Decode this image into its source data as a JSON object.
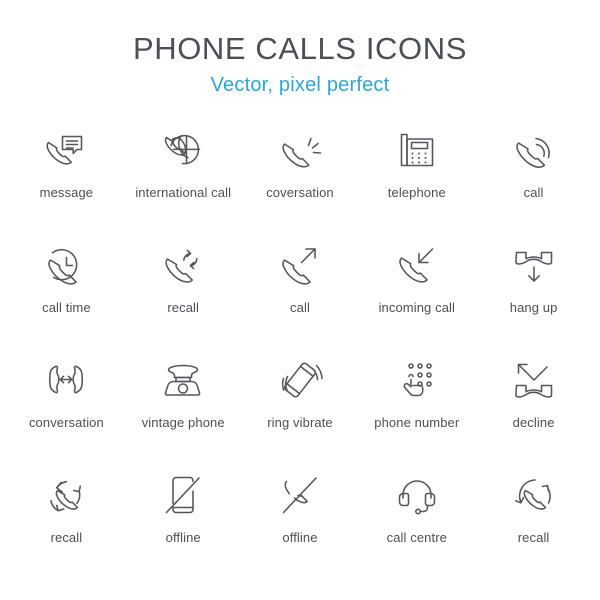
{
  "header": {
    "title": "PHONE CALLS ICONS",
    "subtitle": "Vector, pixel perfect",
    "title_color": "#4a4f58",
    "subtitle_color": "#29a8e0"
  },
  "style": {
    "background": "#ffffff",
    "icon_stroke_color": "#54565c",
    "label_color": "#4d4f55"
  },
  "grid": {
    "columns": 5,
    "rows": 4,
    "count": 20
  },
  "icons": [
    {
      "label": "message",
      "icon_name": "phone-message-icon"
    },
    {
      "label": "international call",
      "icon_name": "globe-phone-icon"
    },
    {
      "label": "coversation",
      "icon_name": "phone-ringing-lines-icon"
    },
    {
      "label": "telephone",
      "icon_name": "desk-telephone-icon"
    },
    {
      "label": "call",
      "icon_name": "phone-signal-arcs-icon"
    },
    {
      "label": "call time",
      "icon_name": "phone-clock-icon"
    },
    {
      "label": "recall",
      "icon_name": "phone-refresh-icon"
    },
    {
      "label": "call",
      "icon_name": "phone-outgoing-arrow-icon"
    },
    {
      "label": "incoming call",
      "icon_name": "phone-incoming-arrow-icon"
    },
    {
      "label": "hang up",
      "icon_name": "handset-down-arrow-icon"
    },
    {
      "label": "conversation",
      "icon_name": "two-handsets-arrow-icon"
    },
    {
      "label": "vintage phone",
      "icon_name": "vintage-rotary-phone-icon"
    },
    {
      "label": "ring vibrate",
      "icon_name": "mobile-vibrate-icon"
    },
    {
      "label": "phone number",
      "icon_name": "keypad-hand-icon"
    },
    {
      "label": "decline",
      "icon_name": "handset-decline-arrow-icon"
    },
    {
      "label": "recall",
      "icon_name": "phone-circular-arrows-icon"
    },
    {
      "label": "offline",
      "icon_name": "mobile-slash-icon"
    },
    {
      "label": "offline",
      "icon_name": "handset-slash-icon"
    },
    {
      "label": "call centre",
      "icon_name": "headset-icon"
    },
    {
      "label": "recall",
      "icon_name": "phone-circle-rotate-icon"
    }
  ]
}
